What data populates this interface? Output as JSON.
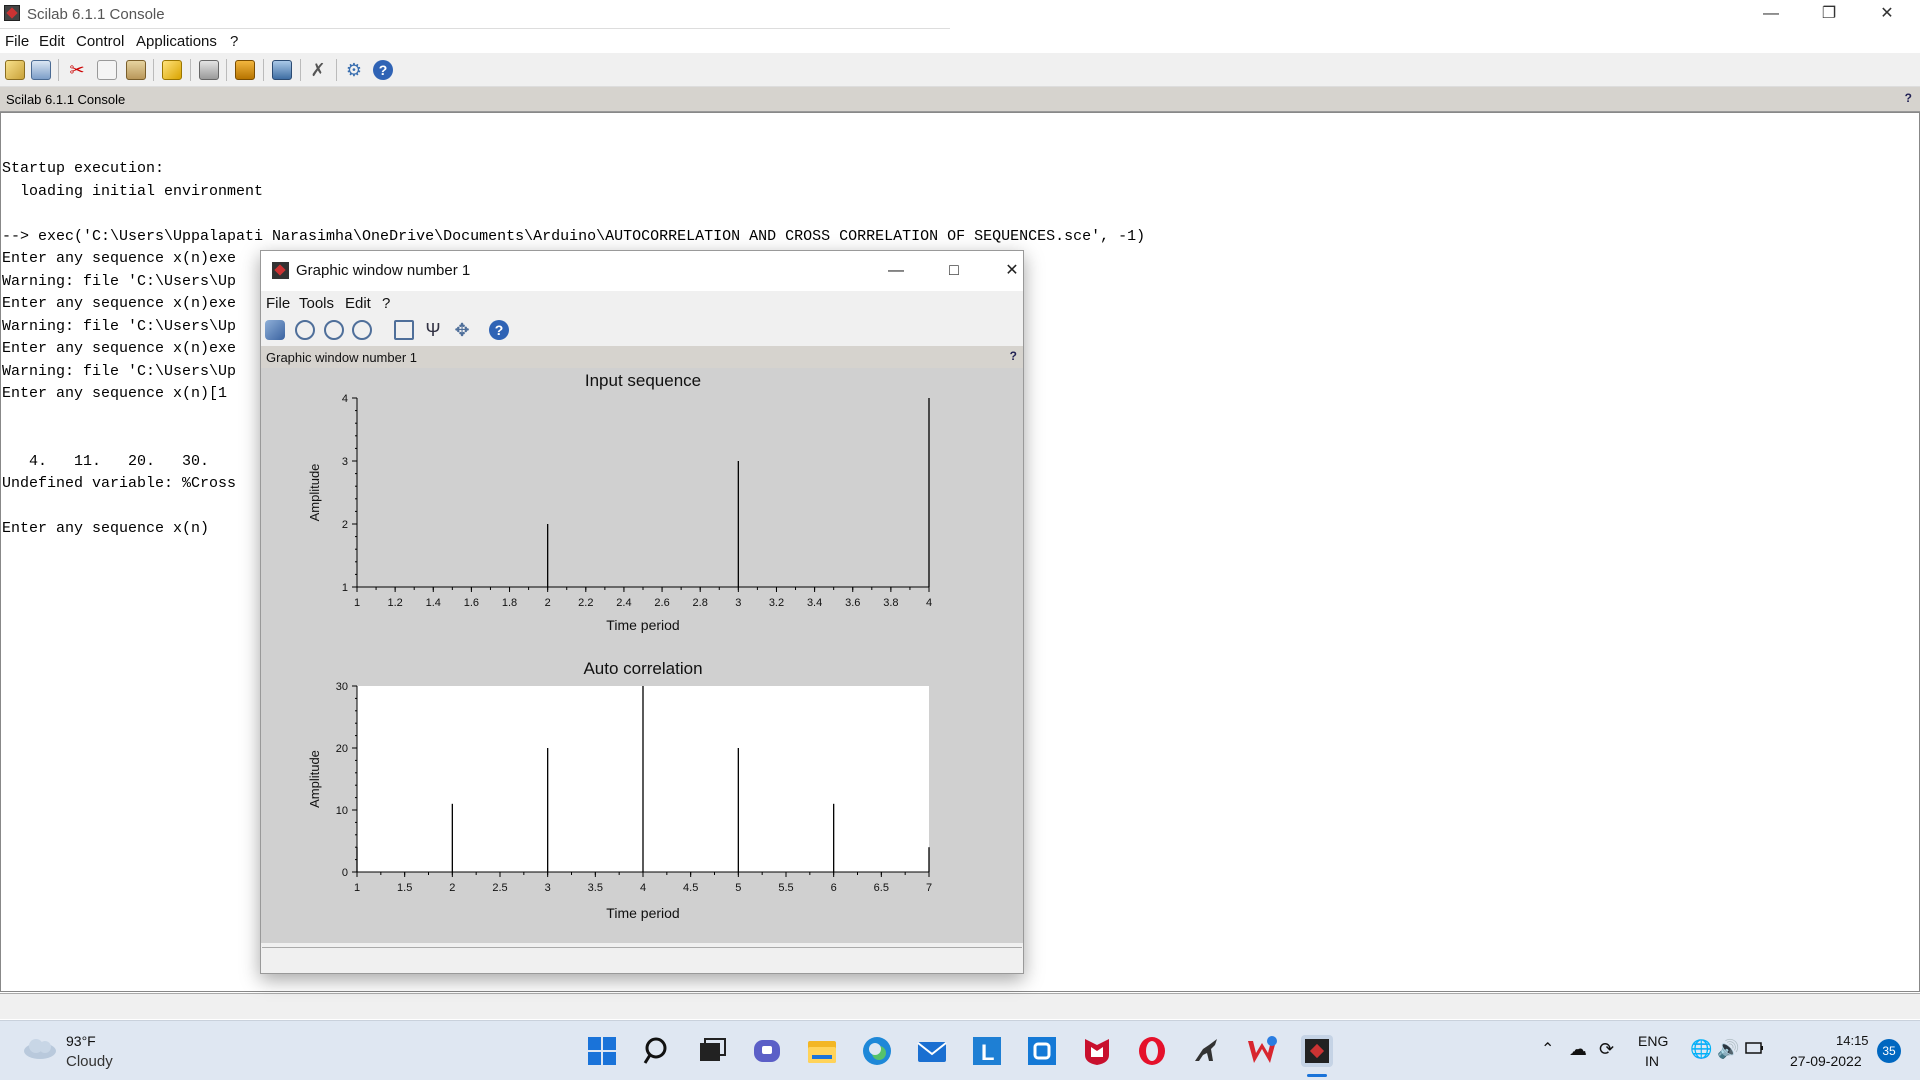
{
  "window": {
    "title": "Scilab 6.1.1 Console"
  },
  "menu": [
    "File",
    "Edit",
    "Control",
    "Applications",
    "?"
  ],
  "toolbar_icons": [
    "new-script-icon",
    "open-file-icon",
    "cut-icon",
    "copy-icon",
    "paste-icon",
    "change-directory-icon",
    "print-icon",
    "clear-console-icon",
    "console-icon",
    "module-manager-icon",
    "preferences-icon",
    "help-icon"
  ],
  "console": {
    "header": "Scilab 6.1.1 Console",
    "help": "?",
    "lines": [
      "Startup execution:",
      "  loading initial environment",
      "",
      "--> exec('C:\\Users\\Uppalapati Narasimha\\OneDrive\\Documents\\Arduino\\AUTOCORRELATION AND CROSS CORRELATION OF SEQUENCES.sce', -1)",
      "Enter any sequence x(n)exe                                 AND CROSS CORRELATION OF SEQUENCES.sce', -1)",
      "Warning: file 'C:\\Users\\Up                                 ELATION OF SEQUENCES.sce' already opened in Scilab.",
      "Enter any sequence x(n)exe                                 AND CROSS CORRELATION OF SEQUENCES.sce', -1)",
      "Warning: file 'C:\\Users\\Up                                 ELATION OF SEQUENCES.sce' already opened in Scilab.",
      "Enter any sequence x(n)exe                                 AND CROSS CORRELATION OF SEQUENCES.sce', -1)",
      "Warning: file 'C:\\Users\\Up                                 ELATION OF SEQUENCES.sce' already opened in Scilab.",
      "Enter any sequence x(n)[1",
      "",
      "",
      "   4.   11.   20.   30.",
      "Undefined variable: %Cross",
      "",
      "Enter any sequence x(n)"
    ]
  },
  "graphic_window": {
    "title": "Graphic window number 1",
    "menu": [
      "File",
      "Tools",
      "Edit",
      "?"
    ],
    "header": "Graphic window number 1",
    "help": "?",
    "tool_icons": [
      "rotate-icon",
      "zoom-area-icon",
      "zoom-in-icon",
      "zoom-out-icon",
      "figure-icon",
      "datatip-icon",
      "pan-icon",
      "help-icon"
    ]
  },
  "chart_data": [
    {
      "type": "stem",
      "title": "Input sequence",
      "xlabel": "Time period",
      "ylabel": "Amplitude",
      "x": [
        2,
        3,
        4
      ],
      "values": [
        2,
        3,
        4
      ],
      "xlim": [
        1,
        4
      ],
      "ylim": [
        1,
        4
      ],
      "xticks": [
        "1",
        "1.2",
        "1.4",
        "1.6",
        "1.8",
        "2",
        "2.2",
        "2.4",
        "2.6",
        "2.8",
        "3",
        "3.2",
        "3.4",
        "3.6",
        "3.8",
        "4"
      ],
      "yticks": [
        "1",
        "2",
        "3",
        "4"
      ],
      "background": "#d0d0d0"
    },
    {
      "type": "stem",
      "title": "Auto correlation",
      "xlabel": "Time period",
      "ylabel": "Amplitude",
      "x": [
        1,
        2,
        3,
        4,
        5,
        6,
        7
      ],
      "values": [
        4,
        11,
        20,
        30,
        20,
        11,
        4
      ],
      "xlim": [
        1,
        7
      ],
      "ylim": [
        0,
        30
      ],
      "xticks": [
        "1",
        "1.5",
        "2",
        "2.5",
        "3",
        "3.5",
        "4",
        "4.5",
        "5",
        "5.5",
        "6",
        "6.5",
        "7"
      ],
      "yticks": [
        "0",
        "10",
        "20",
        "30"
      ],
      "background": "#ffffff"
    }
  ],
  "taskbar": {
    "weather_temp": "93°F",
    "weather_desc": "Cloudy",
    "lang_top": "ENG",
    "lang_bottom": "IN",
    "time": "14:15",
    "date": "27-09-2022",
    "badge": "35",
    "apps": [
      "start-icon",
      "search-icon",
      "task-view-icon",
      "teams-chat-icon",
      "file-explorer-icon",
      "edge-icon",
      "mail-icon",
      "l-app-icon",
      "o-app-icon",
      "mcafee-icon",
      "opera-icon",
      "dino-app-icon",
      "wps-office-icon",
      "scilab-icon"
    ]
  }
}
